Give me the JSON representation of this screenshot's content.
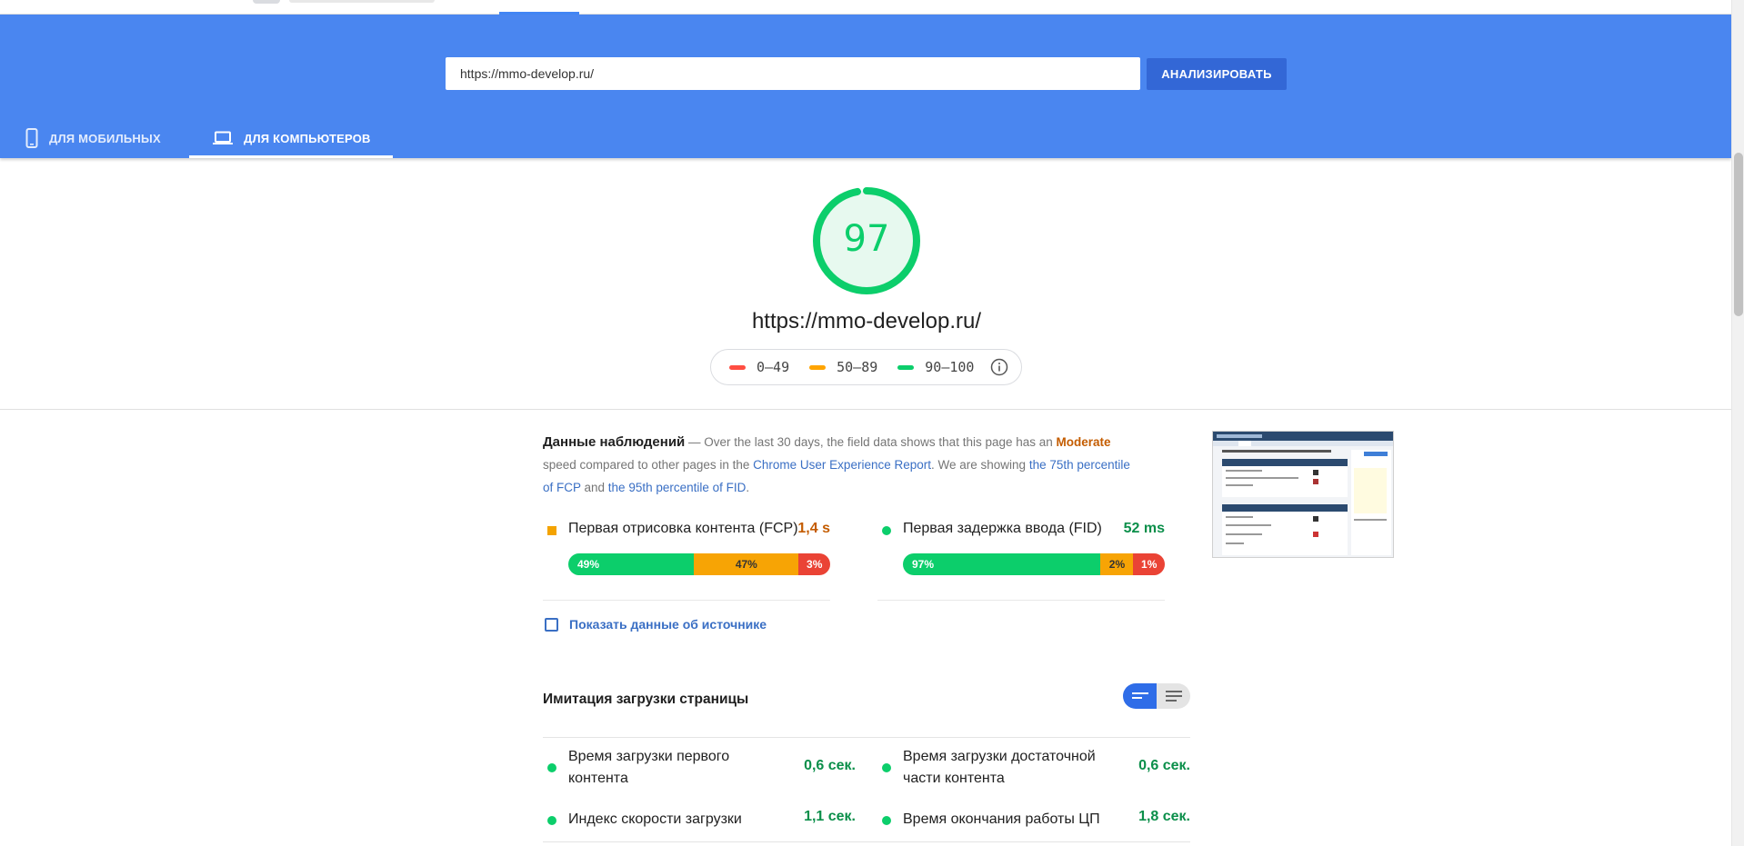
{
  "search": {
    "value": "https://mmo-develop.ru/",
    "button": "АНАЛИЗИРОВАТЬ"
  },
  "tabs": [
    {
      "label": "ДЛЯ МОБИЛЬНЫХ",
      "active": false
    },
    {
      "label": "ДЛЯ КОМПЬЮТЕРОВ",
      "active": true
    }
  ],
  "score": {
    "value": 97,
    "color": "#0cce6b",
    "url": "https://mmo-develop.ru/"
  },
  "legend": [
    {
      "label": "0–49",
      "color": "#ff4e42"
    },
    {
      "label": "50–89",
      "color": "#ffa400"
    },
    {
      "label": "90–100",
      "color": "#0cce6b"
    }
  ],
  "field": {
    "heading": "Данные наблюдений",
    "t1": " — Over the last 30 days, the field data shows that this page has an ",
    "category": "Moderate",
    "t2": " speed compared to other pages in the ",
    "link1": "Chrome User Experience Report",
    "t3": ". We are showing ",
    "link2": "the 75th percentile of FCP",
    "t4": " and ",
    "link3": "the 95th percentile of FID",
    "t5": ".",
    "metrics": [
      {
        "title": "Первая отрисовка контента (FCP)",
        "value": "1,4 s",
        "value_color": "#c45c00",
        "fast": 49,
        "average": 47,
        "slow": 3,
        "fast_label": "49%",
        "average_label": "47%",
        "slow_label": "3%"
      },
      {
        "title": "Первая задержка ввода (FID)",
        "value": "52 ms",
        "value_color": "#0b8f4a",
        "fast": 97,
        "average": 2,
        "slow": 1,
        "fast_label": "97%",
        "average_label": "2%",
        "slow_label": "1%"
      }
    ],
    "show_origin": "Показать данные об источнике"
  },
  "lab": {
    "heading": "Имитация загрузки страницы",
    "metrics": [
      {
        "title": "Время загрузки первого контента",
        "value": "0,6 сек."
      },
      {
        "title": "Время загрузки достаточной части контента",
        "value": "0,6 сек."
      },
      {
        "title": "Индекс скорости загрузки",
        "value": "1,1 сек."
      },
      {
        "title": "Время окончания работы ЦП",
        "value": "1,8 сек."
      }
    ]
  }
}
